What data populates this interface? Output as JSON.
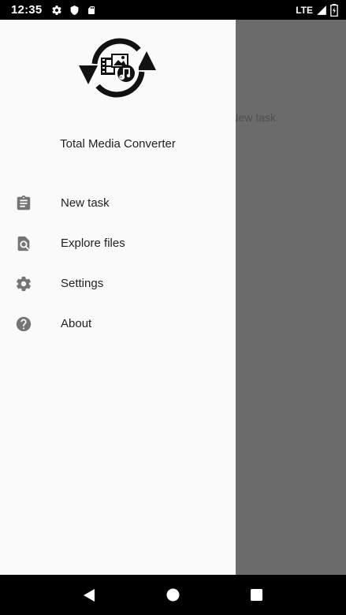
{
  "status_bar": {
    "time": "12:35",
    "network": "LTE",
    "icons": [
      "settings-icon",
      "shield-icon",
      "sd-card-icon",
      "signal-icon",
      "battery-icon"
    ]
  },
  "background_app": {
    "partial_text": "New task"
  },
  "drawer": {
    "app_name": "Total Media Converter",
    "menu": [
      {
        "label": "New task",
        "icon": "clipboard-icon"
      },
      {
        "label": "Explore files",
        "icon": "file-search-icon"
      },
      {
        "label": "Settings",
        "icon": "gear-icon"
      },
      {
        "label": "About",
        "icon": "help-icon"
      }
    ]
  },
  "nav_bar": {
    "buttons": [
      "back-button",
      "home-button",
      "recents-button"
    ]
  },
  "colors": {
    "drawer_bg": "#fafafa",
    "scrim": "#6b6b6b",
    "icon_gray": "#757575",
    "text_dark": "#212121"
  }
}
